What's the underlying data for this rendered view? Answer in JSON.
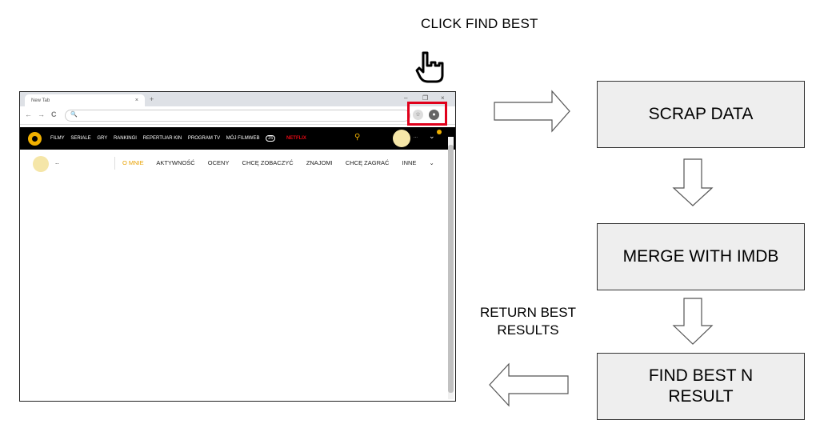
{
  "caption": "CLICK FIND BEST",
  "browser": {
    "tab_title": "New Tab",
    "tab_close": "×",
    "new_tab": "+",
    "window_controls": [
      "–",
      "❐",
      "×"
    ],
    "nav_buttons": [
      "←",
      "→",
      "C"
    ],
    "omnibox_icon": "🔍",
    "site_nav": [
      "FILMY",
      "SERIALE",
      "GRY",
      "RANKINGI",
      "REPERTUAR KIN",
      "PROGRAM TV",
      "MÓJ FILMWEB"
    ],
    "badge_count": "25",
    "netflix": "NETFLIX",
    "username": "..",
    "avatar_dots": "...",
    "profile_tabs": [
      "O MNIE",
      "AKTYWNOŚĆ",
      "OCENY",
      "CHCĘ ZOBACZYĆ",
      "ZNAJOMI",
      "CHCĘ ZAGRAĆ",
      "INNE"
    ],
    "inne_chevron": "⌄",
    "accent_color": "#e8a100",
    "highlight_color": "#e0001b"
  },
  "flow": {
    "scrap_data": "SCRAP DATA",
    "merge": "MERGE WITH IMDB",
    "find_best": "FIND BEST N RESULT",
    "return_label": "RETURN BEST RESULTS"
  }
}
